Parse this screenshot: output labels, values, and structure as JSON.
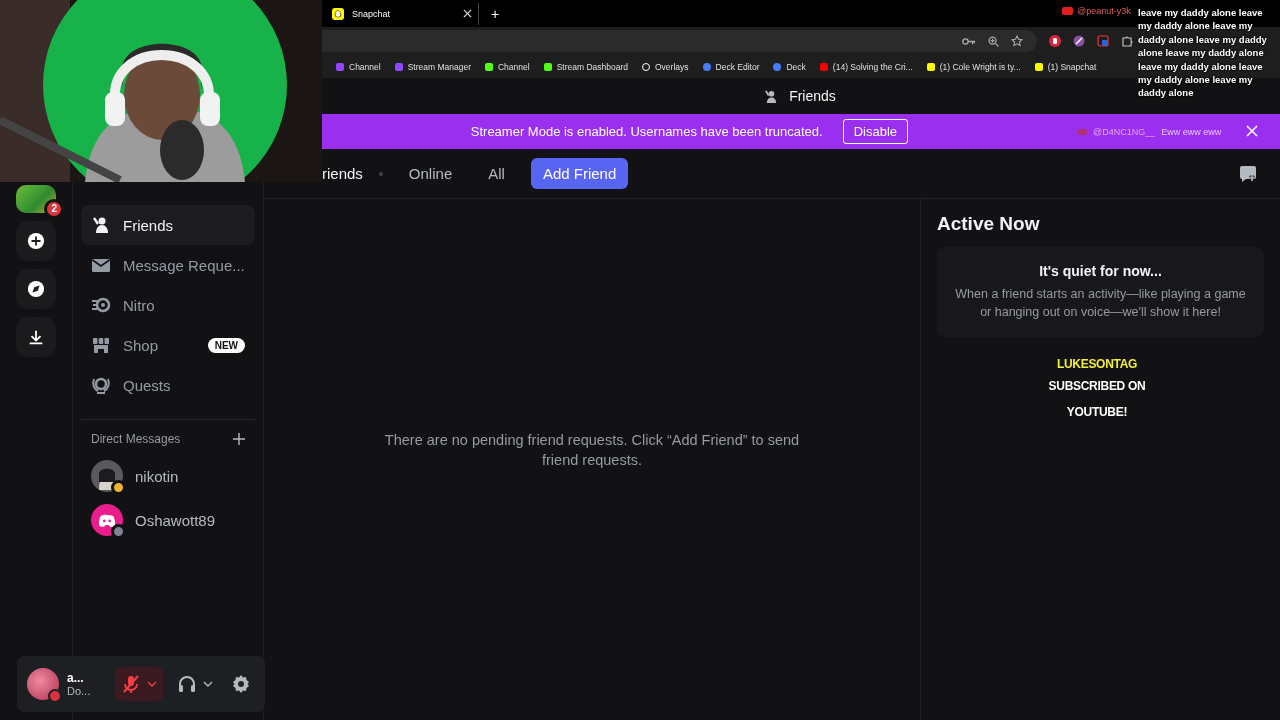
{
  "browser": {
    "tabs": [
      {
        "label": "Snapchat",
        "selected": true
      }
    ],
    "new_tab": "+",
    "bookmarks": [
      {
        "label": "Channel",
        "kind": "twitch"
      },
      {
        "label": "Stream Manager",
        "kind": "twitch"
      },
      {
        "label": "Channel",
        "kind": "kick"
      },
      {
        "label": "Stream Dashboard",
        "kind": "kick"
      },
      {
        "label": "Overlays",
        "kind": "anchor"
      },
      {
        "label": "Deck Editor",
        "kind": "deck"
      },
      {
        "label": "Deck",
        "kind": "deck"
      },
      {
        "label": "(14) Solving the Cri...",
        "kind": "youtube"
      },
      {
        "label": "(1) Cole Wright is ty...",
        "kind": "snapchat"
      },
      {
        "label": "(1) Snapchat",
        "kind": "snapchat"
      }
    ]
  },
  "discord": {
    "title": "Friends",
    "banner": {
      "text": "Streamer Mode is enabled. Usernames have been truncated.",
      "button": "Disable"
    },
    "server_badge": "2",
    "header": {
      "title": "riends",
      "tabs": [
        {
          "label": "Online",
          "selected": false
        },
        {
          "label": "All",
          "selected": false
        }
      ],
      "add_friend": "Add Friend"
    },
    "nav": [
      {
        "label": "Friends",
        "kind": "friends",
        "selected": true
      },
      {
        "label": "Message Reque...",
        "kind": "mail",
        "selected": false
      },
      {
        "label": "Nitro",
        "kind": "nitro",
        "selected": false
      },
      {
        "label": "Shop",
        "kind": "shop",
        "selected": false,
        "badge": "NEW"
      },
      {
        "label": "Quests",
        "kind": "quests",
        "selected": false
      }
    ],
    "dm_heading": "Direct Messages",
    "dms": [
      {
        "name": "nikotin",
        "color": "#f0b232"
      },
      {
        "name": "Oshawott89",
        "color": "#80848e",
        "kind": "default"
      }
    ],
    "user": {
      "name": "a...",
      "status": "Do...",
      "muted": true
    },
    "empty_message": "There are no pending friend requests. Click “Add Friend” to send friend requests.",
    "active_now": {
      "title": "Active Now",
      "card_title": "It's quiet for now...",
      "card_text": "When a friend starts an activity—like playing a game or hanging out on voice—we'll show it here!"
    }
  },
  "overlay": {
    "chat": [
      {
        "author": "@peanut-y3k",
        "text": "leave my daddy alone leave my daddy alone leave my daddy alone leave my daddy alone leave my daddy alone leave my daddy alone leave my daddy alone leave my daddy alone"
      }
    ],
    "banner_chat": {
      "author": "@D4NC1NG__",
      "text": "Eww eww eww"
    },
    "alert": {
      "name": "LUKESONTAG",
      "text": "SUBSCRIBED ON YOUTUBE!"
    }
  }
}
